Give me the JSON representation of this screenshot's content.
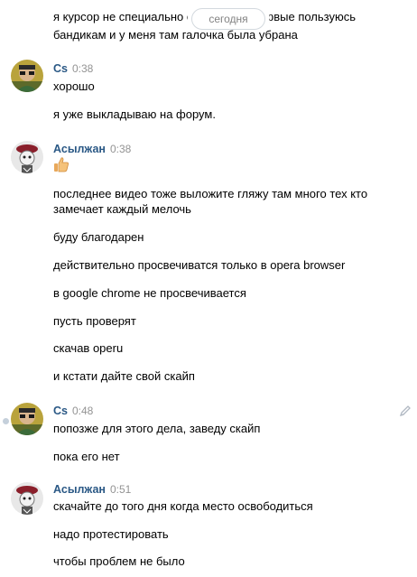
{
  "date_separator": "сегодня",
  "top_messages": {
    "line1_left": "я курсор не специально с",
    "line1_right": "рвые пользуюсь",
    "line2": "бандикам и у меня там галочка была убрана"
  },
  "groups": [
    {
      "author": "Cs",
      "time": "0:38",
      "messages": [
        "хорошо",
        "я уже выкладываю на форум."
      ]
    },
    {
      "author": "Асылжан",
      "time": "0:38",
      "emoji": "thumbs-up",
      "messages": [
        "последнее видео тоже выложите гляжу там много тех кто",
        "замечает каждый мелочь",
        "буду благодарен",
        "действительно просвечиватся только в opera browser",
        "в google chrome не просвечивается",
        "пусть проверят",
        "скачав operu",
        "и кстати дайте свой скайп"
      ]
    },
    {
      "author": "Cs",
      "time": "0:48",
      "messages": [
        "попозже для этого дела, заведу скайп",
        "пока его нет"
      ]
    },
    {
      "author": "Асылжан",
      "time": "0:51",
      "messages": [
        "скачайте до того дня когда место освободиться",
        "надо протестировать",
        "чтобы проблем не было"
      ]
    }
  ],
  "colors": {
    "author_name": "#2a5885",
    "timestamp": "#939393",
    "text": "#000000"
  }
}
